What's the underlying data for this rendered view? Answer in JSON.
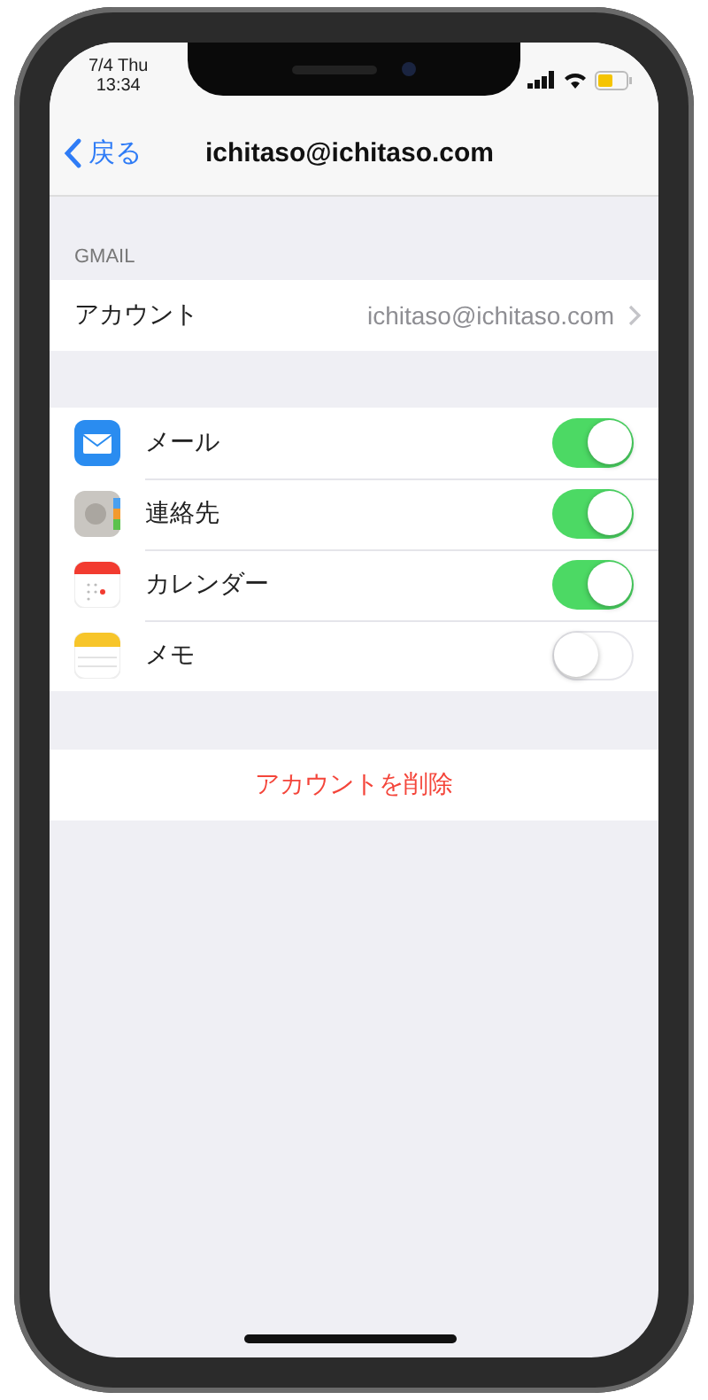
{
  "status_bar": {
    "date": "7/4 Thu",
    "time": "13:34"
  },
  "nav": {
    "back": "戻る",
    "title": "ichitaso@ichitaso.com"
  },
  "section_header": "GMAIL",
  "account_row": {
    "label": "アカウント",
    "value": "ichitaso@ichitaso.com"
  },
  "services": [
    {
      "label": "メール",
      "on": true
    },
    {
      "label": "連絡先",
      "on": true
    },
    {
      "label": "カレンダー",
      "on": true
    },
    {
      "label": "メモ",
      "on": false
    }
  ],
  "delete_button": "アカウントを削除"
}
